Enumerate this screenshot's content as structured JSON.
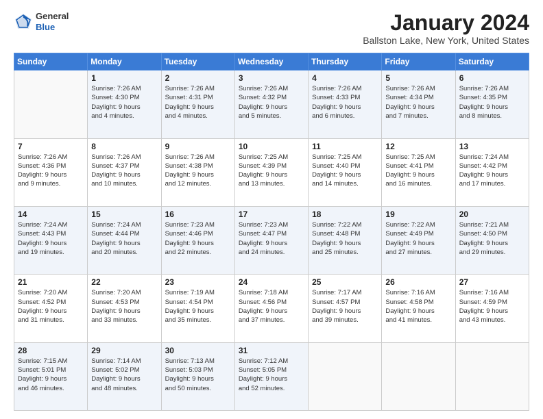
{
  "logo": {
    "general": "General",
    "blue": "Blue"
  },
  "header": {
    "month_year": "January 2024",
    "location": "Ballston Lake, New York, United States"
  },
  "weekdays": [
    "Sunday",
    "Monday",
    "Tuesday",
    "Wednesday",
    "Thursday",
    "Friday",
    "Saturday"
  ],
  "weeks": [
    [
      {
        "day": "",
        "info": ""
      },
      {
        "day": "1",
        "info": "Sunrise: 7:26 AM\nSunset: 4:30 PM\nDaylight: 9 hours\nand 4 minutes."
      },
      {
        "day": "2",
        "info": "Sunrise: 7:26 AM\nSunset: 4:31 PM\nDaylight: 9 hours\nand 4 minutes."
      },
      {
        "day": "3",
        "info": "Sunrise: 7:26 AM\nSunset: 4:32 PM\nDaylight: 9 hours\nand 5 minutes."
      },
      {
        "day": "4",
        "info": "Sunrise: 7:26 AM\nSunset: 4:33 PM\nDaylight: 9 hours\nand 6 minutes."
      },
      {
        "day": "5",
        "info": "Sunrise: 7:26 AM\nSunset: 4:34 PM\nDaylight: 9 hours\nand 7 minutes."
      },
      {
        "day": "6",
        "info": "Sunrise: 7:26 AM\nSunset: 4:35 PM\nDaylight: 9 hours\nand 8 minutes."
      }
    ],
    [
      {
        "day": "7",
        "info": "Sunrise: 7:26 AM\nSunset: 4:36 PM\nDaylight: 9 hours\nand 9 minutes."
      },
      {
        "day": "8",
        "info": "Sunrise: 7:26 AM\nSunset: 4:37 PM\nDaylight: 9 hours\nand 10 minutes."
      },
      {
        "day": "9",
        "info": "Sunrise: 7:26 AM\nSunset: 4:38 PM\nDaylight: 9 hours\nand 12 minutes."
      },
      {
        "day": "10",
        "info": "Sunrise: 7:25 AM\nSunset: 4:39 PM\nDaylight: 9 hours\nand 13 minutes."
      },
      {
        "day": "11",
        "info": "Sunrise: 7:25 AM\nSunset: 4:40 PM\nDaylight: 9 hours\nand 14 minutes."
      },
      {
        "day": "12",
        "info": "Sunrise: 7:25 AM\nSunset: 4:41 PM\nDaylight: 9 hours\nand 16 minutes."
      },
      {
        "day": "13",
        "info": "Sunrise: 7:24 AM\nSunset: 4:42 PM\nDaylight: 9 hours\nand 17 minutes."
      }
    ],
    [
      {
        "day": "14",
        "info": "Sunrise: 7:24 AM\nSunset: 4:43 PM\nDaylight: 9 hours\nand 19 minutes."
      },
      {
        "day": "15",
        "info": "Sunrise: 7:24 AM\nSunset: 4:44 PM\nDaylight: 9 hours\nand 20 minutes."
      },
      {
        "day": "16",
        "info": "Sunrise: 7:23 AM\nSunset: 4:46 PM\nDaylight: 9 hours\nand 22 minutes."
      },
      {
        "day": "17",
        "info": "Sunrise: 7:23 AM\nSunset: 4:47 PM\nDaylight: 9 hours\nand 24 minutes."
      },
      {
        "day": "18",
        "info": "Sunrise: 7:22 AM\nSunset: 4:48 PM\nDaylight: 9 hours\nand 25 minutes."
      },
      {
        "day": "19",
        "info": "Sunrise: 7:22 AM\nSunset: 4:49 PM\nDaylight: 9 hours\nand 27 minutes."
      },
      {
        "day": "20",
        "info": "Sunrise: 7:21 AM\nSunset: 4:50 PM\nDaylight: 9 hours\nand 29 minutes."
      }
    ],
    [
      {
        "day": "21",
        "info": "Sunrise: 7:20 AM\nSunset: 4:52 PM\nDaylight: 9 hours\nand 31 minutes."
      },
      {
        "day": "22",
        "info": "Sunrise: 7:20 AM\nSunset: 4:53 PM\nDaylight: 9 hours\nand 33 minutes."
      },
      {
        "day": "23",
        "info": "Sunrise: 7:19 AM\nSunset: 4:54 PM\nDaylight: 9 hours\nand 35 minutes."
      },
      {
        "day": "24",
        "info": "Sunrise: 7:18 AM\nSunset: 4:56 PM\nDaylight: 9 hours\nand 37 minutes."
      },
      {
        "day": "25",
        "info": "Sunrise: 7:17 AM\nSunset: 4:57 PM\nDaylight: 9 hours\nand 39 minutes."
      },
      {
        "day": "26",
        "info": "Sunrise: 7:16 AM\nSunset: 4:58 PM\nDaylight: 9 hours\nand 41 minutes."
      },
      {
        "day": "27",
        "info": "Sunrise: 7:16 AM\nSunset: 4:59 PM\nDaylight: 9 hours\nand 43 minutes."
      }
    ],
    [
      {
        "day": "28",
        "info": "Sunrise: 7:15 AM\nSunset: 5:01 PM\nDaylight: 9 hours\nand 46 minutes."
      },
      {
        "day": "29",
        "info": "Sunrise: 7:14 AM\nSunset: 5:02 PM\nDaylight: 9 hours\nand 48 minutes."
      },
      {
        "day": "30",
        "info": "Sunrise: 7:13 AM\nSunset: 5:03 PM\nDaylight: 9 hours\nand 50 minutes."
      },
      {
        "day": "31",
        "info": "Sunrise: 7:12 AM\nSunset: 5:05 PM\nDaylight: 9 hours\nand 52 minutes."
      },
      {
        "day": "",
        "info": ""
      },
      {
        "day": "",
        "info": ""
      },
      {
        "day": "",
        "info": ""
      }
    ]
  ]
}
